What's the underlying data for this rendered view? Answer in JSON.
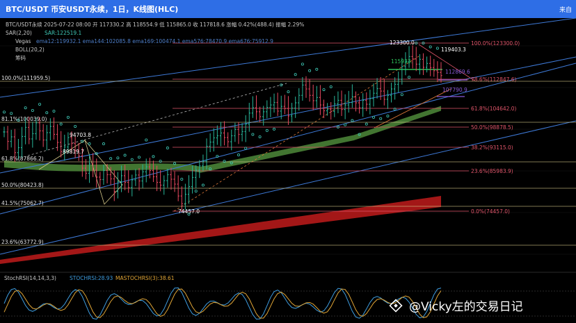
{
  "header": {
    "title": "BTC/USDT 币安USDT永续，1日，K线图(HLC)",
    "right_text": "来自"
  },
  "info": {
    "line1": "BTC/USDT永续  2025-07-22 08:00  开 117330.2  高 118554.9  低 115865.0  收 117818.6  涨幅 0.42%(488.4)  振幅 2.29%",
    "sar": "SAR(2,20)",
    "sar_value": "SAR:122519.1",
    "vegas": "Vegas",
    "vegas_values": "ema12:119932.1   ema144:102085.8   ema169:100474.1   ema576:78470.9   ema676:75912.9",
    "boll": "BOLL(20,2)",
    "chip": "筹码"
  },
  "stoch": {
    "label": "StochRSI(14,14,3,3)",
    "k": "STOCHRSI:28.93",
    "d": "MASTOCHRSI(3):38.61"
  },
  "watermark": "@Vicky左的交易日记",
  "colors": {
    "up": "#29b69a",
    "down": "#e5485f",
    "fib": "#e0556a",
    "level_line": "#d7c98a",
    "sar": "#3fc8b6",
    "trend": "#3e7ad8",
    "vegas_green": "#4e8a3a",
    "vegas_red": "#b51a1a"
  },
  "chart_data": {
    "type": "candlestick",
    "ylim": [
      55000,
      130000
    ],
    "fib_levels": [
      {
        "label": "100.0%(123300.0)",
        "value": 123300
      },
      {
        "label": "78.6%(112847.6)",
        "value": 112847.6
      },
      {
        "label": "61.8%(104642.0)",
        "value": 104642
      },
      {
        "label": "50.0%(98878.5)",
        "value": 98878.5
      },
      {
        "label": "38.2%(93115.0)",
        "value": 93115
      },
      {
        "label": "23.6%(85983.9)",
        "value": 85983.9
      },
      {
        "label": "0.0%(74457.0)",
        "value": 74457
      }
    ],
    "left_levels": [
      {
        "label": "100.0%(111959.5)",
        "value": 111959.5
      },
      {
        "label": "81.1%(100039.0)",
        "value": 100039
      },
      {
        "label": "61.8%(87866.2)",
        "value": 87866.2
      },
      {
        "label": "50.0%(80423.8)",
        "value": 80423.8
      },
      {
        "label": "41.5%(75062.7)",
        "value": 75062.7
      },
      {
        "label": "23.6%(63772.9)",
        "value": 63772.9
      }
    ],
    "annotations": [
      {
        "text": "123300.0",
        "value": 123300
      },
      {
        "text": "119403.3",
        "value": 119403.3
      },
      {
        "text": "115933.",
        "value": 115933
      },
      {
        "text": "112869.6",
        "value": 112869.6
      },
      {
        "text": "107790.9",
        "value": 107790.9
      },
      {
        "text": "94703.8",
        "value": 94703.8
      },
      {
        "text": "89819.7",
        "value": 89819.7
      },
      {
        "text": "74457.0",
        "value": 74457
      }
    ],
    "closes": [
      97500,
      94800,
      96100,
      91500,
      93000,
      96200,
      98800,
      95500,
      97000,
      100200,
      97800,
      95200,
      97300,
      99100,
      96800,
      94500,
      91800,
      93200,
      95900,
      94200,
      92100,
      90500,
      86800,
      85300,
      88100,
      86200,
      84200,
      83500,
      86100,
      84900,
      83700,
      80100,
      82900,
      84600,
      82700,
      81200,
      83400,
      84800,
      83100,
      85700,
      87200,
      86100,
      84300,
      82700,
      81900,
      83200,
      84900,
      83600,
      82200,
      78800,
      76600,
      79300,
      81500,
      84100,
      86200,
      87500,
      88900,
      93400,
      94600,
      95800,
      96400,
      97200,
      95900,
      94700,
      96400,
      98200,
      96800,
      97600,
      99800,
      103200,
      104800,
      103600,
      102100,
      103600,
      104900,
      105600,
      106300,
      103800,
      105200,
      104600,
      102300,
      104700,
      106200,
      108300,
      111200,
      110100,
      108300,
      106800,
      107700,
      105600,
      103900,
      104400,
      103700,
      105900,
      106900,
      104300,
      105600,
      106300,
      107900,
      106200,
      104800,
      106900,
      105800,
      107400,
      108900,
      110200,
      109500,
      107200,
      108300,
      110100,
      111400,
      112800,
      116500,
      117900,
      119400,
      118700,
      117200,
      118600,
      116300,
      117400,
      116200,
      115300,
      114800,
      113900
    ]
  }
}
